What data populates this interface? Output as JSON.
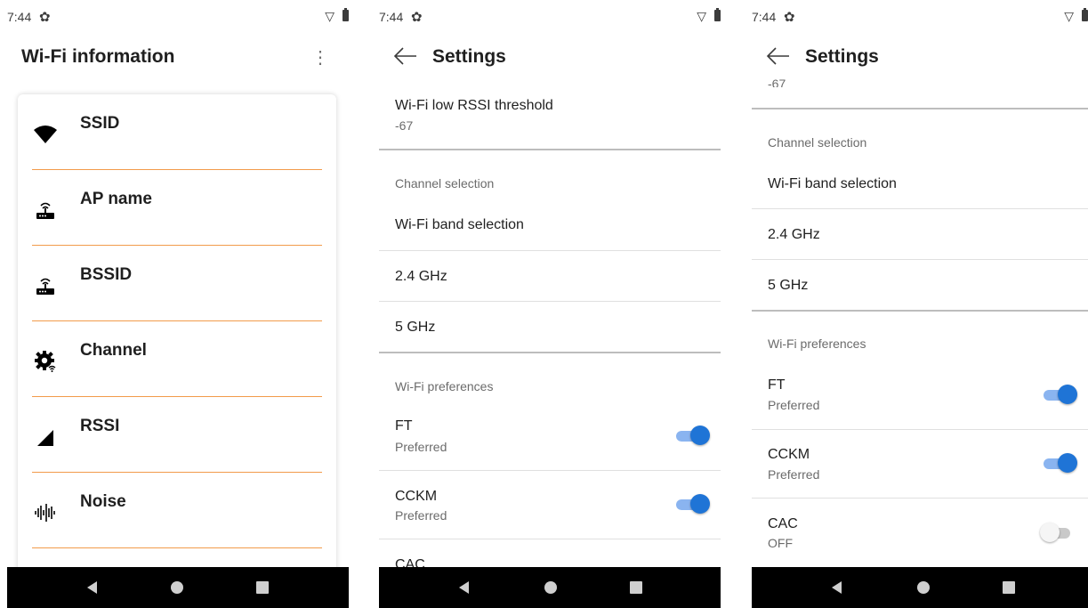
{
  "status": {
    "time": "7:44"
  },
  "panel1": {
    "title": "Wi-Fi information",
    "items": [
      {
        "label": "SSID",
        "icon": "wifi-signal-icon"
      },
      {
        "label": "AP name",
        "icon": "router-icon"
      },
      {
        "label": "BSSID",
        "icon": "router-icon"
      },
      {
        "label": "Channel",
        "icon": "settings-wifi-icon"
      },
      {
        "label": "RSSI",
        "icon": "signal-strength-icon"
      },
      {
        "label": "Noise",
        "icon": "waveform-icon"
      }
    ]
  },
  "panel2": {
    "title": "Settings",
    "rssi": {
      "title": "Wi-Fi low RSSI threshold",
      "value": "-67"
    },
    "channel_category": "Channel selection",
    "band_selection": "Wi-Fi band selection",
    "band_24": "2.4 GHz",
    "band_5": "5 GHz",
    "pref_category": "Wi-Fi preferences",
    "ft": {
      "title": "FT",
      "summary": "Preferred",
      "on": true
    },
    "cckm": {
      "title": "CCKM",
      "summary": "Preferred",
      "on": true
    },
    "cac_partial": "CAC"
  },
  "panel3": {
    "title": "Settings",
    "rssi_value_partial": "-67",
    "channel_category": "Channel selection",
    "band_selection": "Wi-Fi band selection",
    "band_24": "2.4 GHz",
    "band_5": "5 GHz",
    "pref_category": "Wi-Fi preferences",
    "ft": {
      "title": "FT",
      "summary": "Preferred",
      "on": true
    },
    "cckm": {
      "title": "CCKM",
      "summary": "Preferred",
      "on": true
    },
    "cac": {
      "title": "CAC",
      "summary": "OFF",
      "on": false
    }
  },
  "colors": {
    "accent": "#1f74d6",
    "divider_accent": "#f29b4b",
    "navbar": "#000000"
  }
}
